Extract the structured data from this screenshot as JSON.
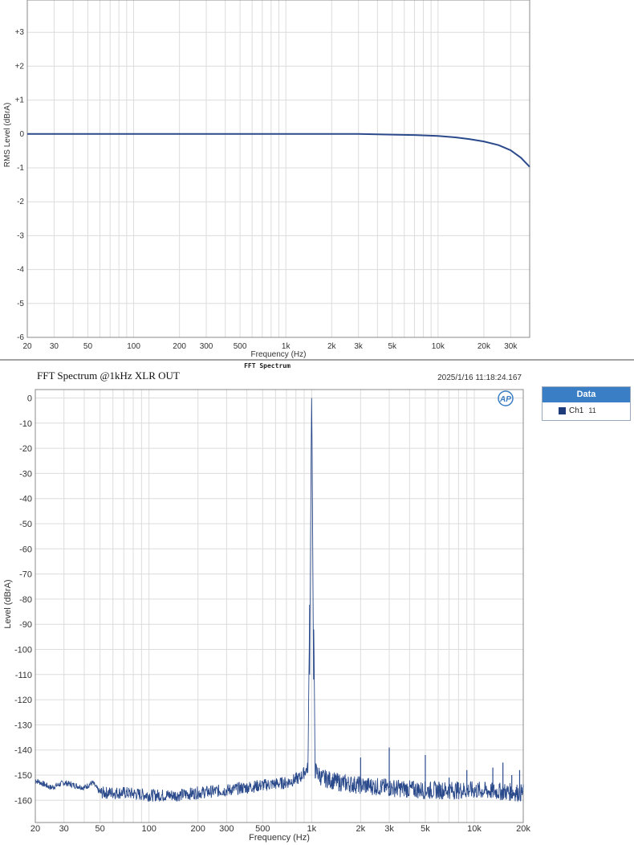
{
  "chart_data": [
    {
      "type": "line",
      "title": "",
      "xlabel": "Frequency (Hz)",
      "ylabel": "RMS Level (dBrA)",
      "x_scale": "log",
      "xlim": [
        20,
        40000
      ],
      "ylim": [
        -6,
        4
      ],
      "grid": true,
      "x_ticks": [
        20,
        30,
        50,
        100,
        200,
        300,
        500,
        1000,
        2000,
        3000,
        5000,
        10000,
        20000,
        30000
      ],
      "x_tick_labels": [
        "20",
        "30",
        "50",
        "100",
        "200",
        "300",
        "500",
        "1k",
        "2k",
        "3k",
        "5k",
        "10k",
        "20k",
        "30k"
      ],
      "y_ticks": [
        3,
        2,
        1,
        0,
        -1,
        -2,
        -3,
        -4,
        -5,
        -6
      ],
      "y_tick_labels": [
        "+3",
        "+2",
        "+1",
        "0",
        "-1",
        "-2",
        "-3",
        "-4",
        "-5",
        "-6"
      ],
      "series": [
        {
          "color": "#2b4a8b",
          "x": [
            20,
            50,
            100,
            500,
            1000,
            3000,
            5000,
            7000,
            10000,
            13000,
            16000,
            20000,
            25000,
            30000,
            35000,
            40000
          ],
          "y": [
            0,
            0,
            0,
            0,
            0,
            0,
            -0.02,
            -0.03,
            -0.06,
            -0.1,
            -0.15,
            -0.22,
            -0.33,
            -0.48,
            -0.7,
            -0.97
          ]
        }
      ]
    },
    {
      "type": "line",
      "title": "FFT Spectrum @1kHz XLR OUT",
      "subtitle": "FFT Spectrum",
      "timestamp": "2025/1/16 11:18:24.167",
      "xlabel": "Frequency (Hz)",
      "ylabel": "Level (dBrA)",
      "x_scale": "log",
      "xlim": [
        20,
        20000
      ],
      "ylim": [
        -165,
        4
      ],
      "grid": true,
      "legend": {
        "title": "Data",
        "position": "right",
        "entries": [
          {
            "label": "Ch1",
            "count": "11"
          }
        ]
      },
      "x_ticks": [
        20,
        30,
        50,
        100,
        200,
        300,
        500,
        1000,
        2000,
        3000,
        5000,
        10000,
        20000
      ],
      "x_tick_labels": [
        "20",
        "30",
        "50",
        "100",
        "200",
        "300",
        "500",
        "1k",
        "2k",
        "3k",
        "5k",
        "10k",
        "20k"
      ],
      "y_ticks": [
        0,
        -10,
        -20,
        -30,
        -40,
        -50,
        -60,
        -70,
        -80,
        -90,
        -100,
        -110,
        -120,
        -130,
        -140,
        -150,
        -160
      ],
      "y_tick_labels": [
        "0",
        "-10",
        "-20",
        "-30",
        "-40",
        "-50",
        "-60",
        "-70",
        "-80",
        "-90",
        "-100",
        "-110",
        "-120",
        "-130",
        "-140",
        "-150",
        "-160"
      ],
      "series": [
        {
          "name": "Ch1",
          "color": "#2b4a8b",
          "noise_floor": [
            [
              20,
              -152
            ],
            [
              25,
              -155
            ],
            [
              30,
              -153
            ],
            [
              40,
              -155
            ],
            [
              45,
              -153
            ],
            [
              50,
              -157
            ],
            [
              70,
              -157
            ],
            [
              100,
              -158
            ],
            [
              150,
              -158
            ],
            [
              200,
              -157
            ],
            [
              300,
              -156
            ],
            [
              500,
              -154
            ],
            [
              700,
              -153
            ],
            [
              850,
              -151
            ],
            [
              950,
              -147
            ],
            [
              1000,
              0
            ],
            [
              1050,
              -148
            ],
            [
              1150,
              -151
            ],
            [
              1500,
              -153
            ],
            [
              2000,
              -154
            ],
            [
              3000,
              -155
            ],
            [
              5000,
              -156
            ],
            [
              10000,
              -156
            ],
            [
              20000,
              -157
            ]
          ],
          "peaks": [
            {
              "x": 1000,
              "y": 0
            },
            {
              "x": 2000,
              "y": -143
            },
            {
              "x": 3000,
              "y": -139
            },
            {
              "x": 5000,
              "y": -142
            },
            {
              "x": 7000,
              "y": -151
            },
            {
              "x": 9000,
              "y": -148
            },
            {
              "x": 13000,
              "y": -147
            },
            {
              "x": 15000,
              "y": -145
            },
            {
              "x": 17000,
              "y": -150
            },
            {
              "x": 19000,
              "y": -148
            }
          ]
        }
      ]
    }
  ]
}
